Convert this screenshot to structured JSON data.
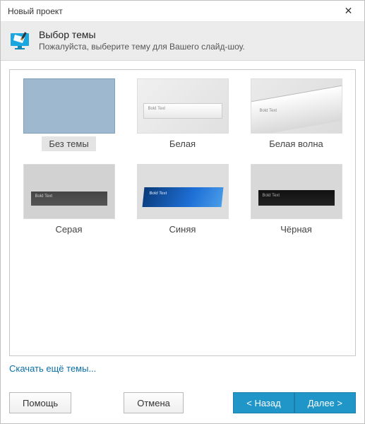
{
  "window": {
    "title": "Новый проект"
  },
  "header": {
    "title": "Выбор темы",
    "subtitle": "Пожалуйста, выберите тему для Вашего слайд-шоу."
  },
  "themes": [
    {
      "id": "none",
      "label": "Без темы",
      "selected": true
    },
    {
      "id": "white",
      "label": "Белая",
      "selected": false
    },
    {
      "id": "wave",
      "label": "Белая волна",
      "selected": false
    },
    {
      "id": "gray",
      "label": "Серая",
      "selected": false
    },
    {
      "id": "blue",
      "label": "Синяя",
      "selected": false
    },
    {
      "id": "black",
      "label": "Чёрная",
      "selected": false
    }
  ],
  "links": {
    "more_themes": "Скачать ещё темы..."
  },
  "buttons": {
    "help": "Помощь",
    "cancel": "Отмена",
    "back": "< Назад",
    "next": "Далее >"
  },
  "colors": {
    "accent": "#2095c8",
    "link": "#0a6ea8"
  }
}
